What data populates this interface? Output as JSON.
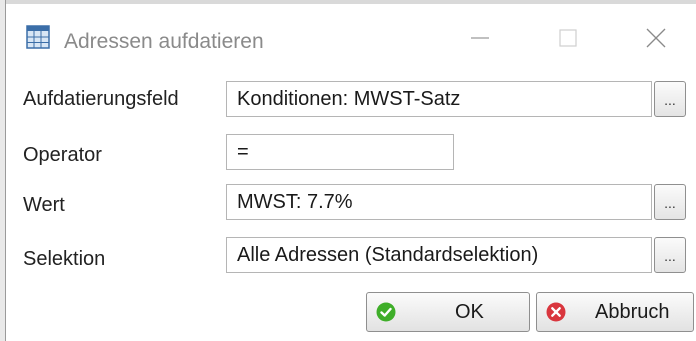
{
  "window": {
    "title": "Adressen aufdatieren",
    "controls": [
      "minimize-icon",
      "maximize-icon",
      "close-icon"
    ]
  },
  "form": {
    "rows": [
      {
        "label": "Aufdatierungsfeld",
        "value": "Konditionen: MWST-Satz",
        "browse": "..."
      },
      {
        "label": "Operator",
        "value": "="
      },
      {
        "label": "Wert",
        "value": "MWST: 7.7%",
        "browse": "..."
      },
      {
        "label": "Selektion",
        "value": "Alle Adressen (Standardselektion)",
        "browse": "..."
      }
    ]
  },
  "buttons": {
    "ok": {
      "label": "OK",
      "icon": "check-circle-icon",
      "color": "#3fae29"
    },
    "cancel": {
      "label": "Abbruch",
      "icon": "x-circle-icon",
      "color": "#d9363e"
    }
  }
}
